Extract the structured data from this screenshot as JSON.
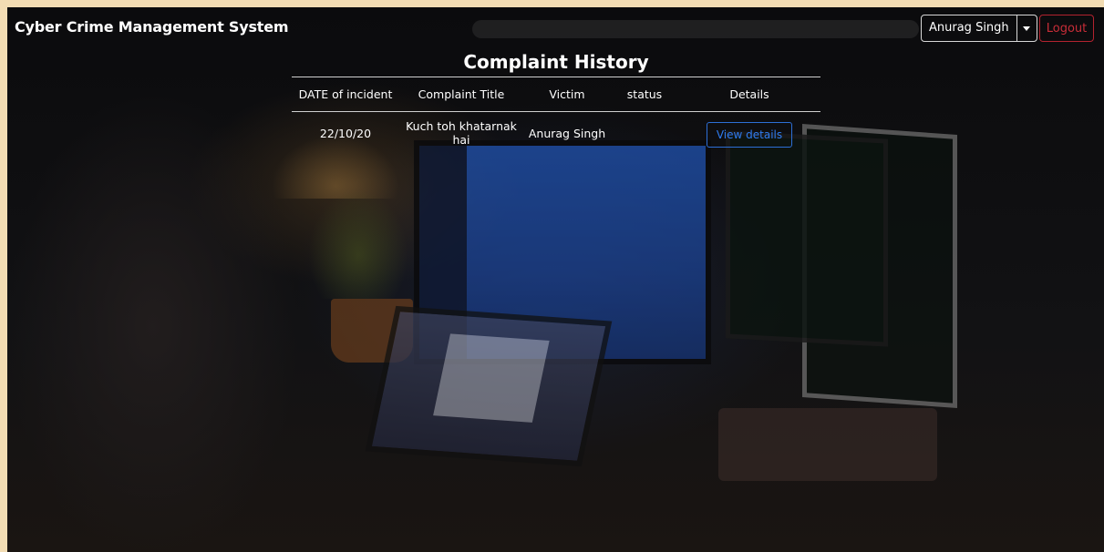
{
  "navbar": {
    "brand": "Cyber Crime Management System",
    "user_name": "Anurag Singh",
    "logout_label": "Logout"
  },
  "complaints": {
    "heading": "Complaint History",
    "columns": [
      "DATE of incident",
      "Complaint Title",
      "Victim",
      "status",
      "Details"
    ],
    "rows": [
      {
        "date": "22/10/20",
        "title": "Kuch toh khatarnak hai",
        "victim": "Anurag Singh",
        "status": "",
        "details_label": "View details"
      }
    ]
  },
  "colors": {
    "logout": "#c82d38",
    "view_details": "#2f7cf0",
    "page_border": "#f2dcb3"
  }
}
